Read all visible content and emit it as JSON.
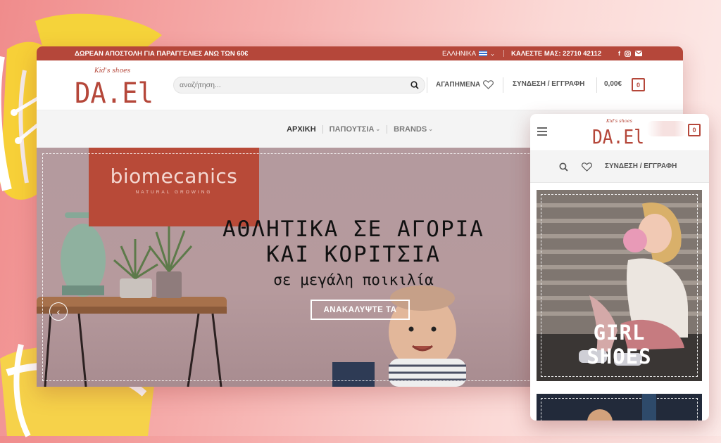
{
  "topbar": {
    "promo": "ΔΩΡΕΑΝ ΑΠΟΣΤΟΛΗ ΓΙΑ ΠΑΡΑΓΓΕΛΙΕΣ ΑΝΩ ΤΩΝ 60€",
    "language": "ΕΛΛΗΝΙΚΑ",
    "phone": "ΚΑΛΕΣΤΕ ΜΑΣ: 22710 42112",
    "socials": [
      "facebook-icon",
      "instagram-icon",
      "email-icon"
    ]
  },
  "logo": {
    "tagline": "Kid's shoes",
    "name": "DA.El"
  },
  "header": {
    "search_placeholder": "αναζήτηση...",
    "favorites": "ΑΓΑΠΗΜΕΝΑ",
    "login": "ΣΥΝΔΕΣΗ / ΕΓΓΡΑΦΗ",
    "cart_total": "0,00€",
    "cart_count": "0"
  },
  "nav": {
    "items": [
      "ΑΡΧΙΚΗ",
      "ΠΑΠΟΥΤΣΙΑ",
      "BRANDS"
    ]
  },
  "hero": {
    "brand": "biomecanics",
    "brand_sub": "NATURAL GROWING",
    "headline_line1": "ΑΘΛΗΤΙΚΑ ΣΕ ΑΓΟΡΙΑ",
    "headline_line2": "ΚΑΙ ΚΟΡΙΤΣΙΑ",
    "subline": "σε μεγάλη ποικιλία",
    "cta": "ΑΝΑΚΑΛΥΨΤΕ ΤΑ"
  },
  "mobile": {
    "login": "ΣΥΝΔΕΣΗ / ΕΓΓΡΑΦΗ",
    "cart_count": "0",
    "card_title_line1": "GIRL",
    "card_title_line2": "SHOES"
  },
  "colors": {
    "brand": "#b5473a",
    "hero_bg": "#b99ea1"
  }
}
